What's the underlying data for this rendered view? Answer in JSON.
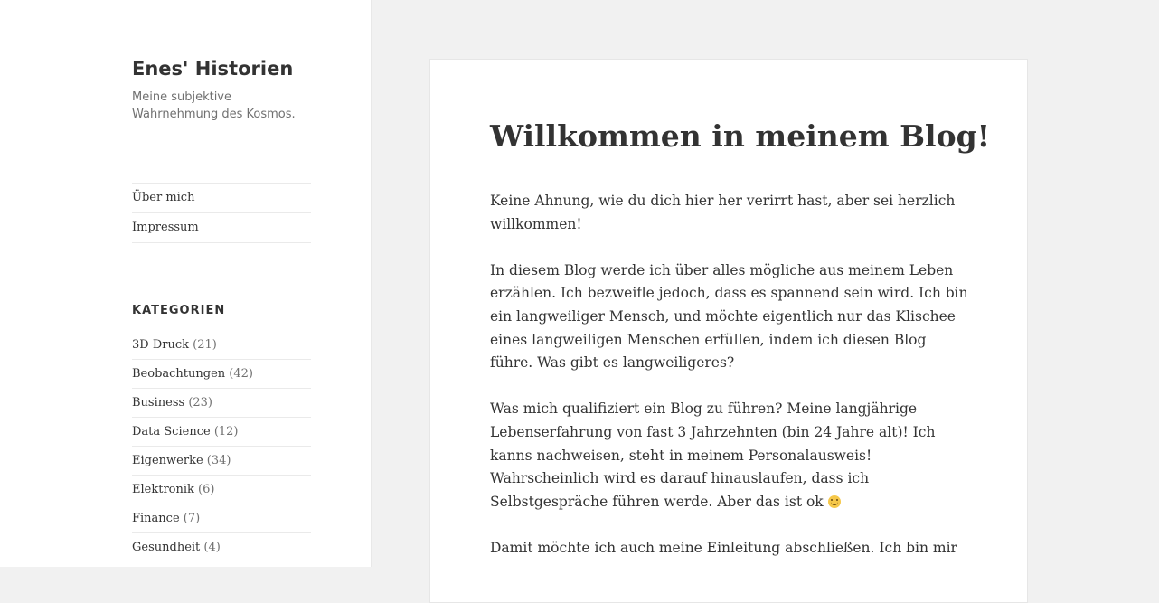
{
  "site": {
    "title": "Enes' Historien",
    "description": "Meine subjektive Wahrnehmung des Kosmos."
  },
  "nav": [
    {
      "label": "Über mich"
    },
    {
      "label": "Impressum"
    }
  ],
  "categories_heading": "KATEGORIEN",
  "categories": [
    {
      "name": "3D Druck",
      "count": "(21)"
    },
    {
      "name": "Beobachtungen",
      "count": "(42)"
    },
    {
      "name": "Business",
      "count": "(23)"
    },
    {
      "name": "Data Science",
      "count": "(12)"
    },
    {
      "name": "Eigenwerke",
      "count": "(34)"
    },
    {
      "name": "Elektronik",
      "count": "(6)"
    },
    {
      "name": "Finance",
      "count": "(7)"
    },
    {
      "name": "Gesundheit",
      "count": "(4)"
    }
  ],
  "post": {
    "title": "Willkommen in meinem Blog!",
    "paragraphs": [
      "Keine Ahnung, wie du dich hier her verirrt hast, aber sei herzlich willkommen!",
      "In diesem Blog werde ich über alles mögliche aus meinem Leben erzählen. Ich bezweifle jedoch, dass es spannend sein wird. Ich bin ein langweiliger Mensch, und möchte eigentlich nur das Klischee eines langweiligen Menschen erfüllen, indem ich diesen Blog führe. Was gibt es langweiligeres?",
      "Was mich qualifiziert ein Blog zu führen? Meine langjährige Lebenserfahrung von fast 3 Jahrzehnten (bin 24 Jahre alt)! Ich kanns nachweisen, steht in meinem Personalausweis! Wahrscheinlich wird es darauf hinauslaufen, dass ich Selbstgespräche führen werde. Aber das ist ok",
      "Damit möchte ich auch meine Einleitung abschließen. Ich bin mir"
    ],
    "emoji_icon": "slightly-smiling-face-icon"
  },
  "colors": {
    "background": "#f1f1f1",
    "panel": "#ffffff",
    "text": "#333333",
    "muted": "#707070",
    "divider": "#eaeaea"
  }
}
